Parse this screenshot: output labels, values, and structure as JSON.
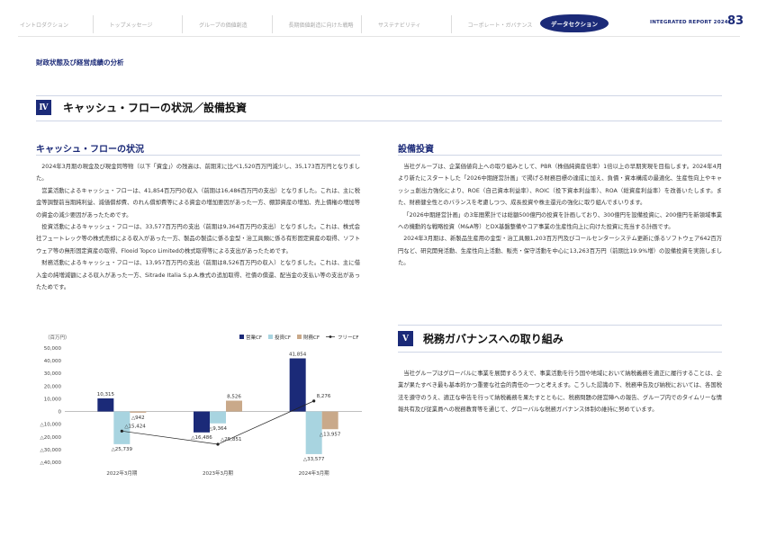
{
  "nav": {
    "items": [
      "イントロダクション",
      "トップメッセージ",
      "グループの価値創造",
      "長期価値創造に向けた戦略",
      "サステナビリティ",
      "コーポレート・ガバナンス"
    ],
    "active": "データセクション"
  },
  "header": {
    "report": "INTEGRATED REPORT 2024",
    "page": "83"
  },
  "section_title": "財政状態及び経営成績の分析",
  "main_heading": {
    "badge": "Ⅳ",
    "title": "キャッシュ・フローの状況／設備投資"
  },
  "cashflow": {
    "heading": "キャッシュ・フローの状況",
    "paragraphs": [
      "2024年3月期の現金及び現金同等物（以下「資金」）の残高は、前期末に比べ1,520百万円減少し、35,173百万円となりました。",
      "営業活動によるキャッシュ・フローは、41,854百万円の収入（前期は16,486百万円の支出）となりました。これは、主に税金等調整前当期純利益、減価償却費、のれん償却費等による資金の増加要因があった一方、棚卸資産の増加、売上債権の増加等の資金の減少要因があったためです。",
      "投資活動によるキャッシュ・フローは、33,577百万円の支出（前期は9,364百万円の支出）となりました。これは、株式会社フュートレック等の株式売却による収入があった一方、製品の製造に係る金型・治工具類に係る有形固定資産の取得、ソフトウェア等の無形固定資産の取得、Flooid Topco Limitedの株式取得等による支出があったためです。",
      "財務活動によるキャッシュ・フローは、13,957百万円の支出（前期は8,526百万円の収入）となりました。これは、主に借入金の純増減額による収入があった一方、Sitrade Italia S.p.A.株式の追加取得、社債の償還、配当金の支払い等の支出があったためです。"
    ]
  },
  "capex": {
    "heading": "設備投資",
    "paragraphs": [
      "当社グループは、企業価値向上への取り組みとして、PBR（株価純資産倍率）1倍以上の早期実現を目指します。2024年4月より新たにスタートした「2026中期経営計画」で掲げる財務目標の達成に加え、負債・資本構成の最適化、生産性向上やキャッシュ創出力強化により、ROE（自己資本利益率）、ROIC（投下資本利益率）、ROA（総資産利益率）を改善いたします。また、財務健全性とのバランスを考慮しつつ、成長投資や株主還元の強化に取り組んでまいります。",
      "「2026中期経営計画」の3年間累計では総額500億円の投資を計画しており、300億円を設備投資に、200億円を新領域事業への機動的な戦略投資（M&A等）とDX基盤整備やコア事業の生産性向上に向けた投資に充当する計画です。",
      "2024年3月期は、新製品生産用の金型・治工具類1,203百万円及びコールセンターシステム更新に係るソフトウェア642百万円など、研究開発活動、生産性向上活動、販売・保守活動を中心に13,263百万円（前期比19.9%増）の設備投資を実施しました。"
    ]
  },
  "tax": {
    "badge": "Ⅴ",
    "heading": "税務ガバナンスへの取り組み",
    "paragraphs": [
      "当社グループはグローバルに事業を展開するうえで、事業活動を行う国や地域において納税義務を適正に履行することは、企業が果たすべき最も基本的かつ重要な社会的責任の一つと考えます。こうした認識の下、税務申告及び納税においては、各国税法を遵守のうえ、適正な申告を行って納税義務を果たすとともに、税務問題の経営陣への報告、グループ内でのタイムリーな情報共有及び従業員への税務教育等を通じて、グローバルな税務ガバナンス体制の維持に努めています。"
    ]
  },
  "chart_data": {
    "type": "bar",
    "unit_label": "（百万円）",
    "categories": [
      "2022年3月期",
      "2023年3月期",
      "2024年3月期"
    ],
    "ylim": [
      -40000,
      50000
    ],
    "yticks": [
      "50,000",
      "40,000",
      "30,000",
      "20,000",
      "10,000",
      "0",
      "△10,000",
      "△20,000",
      "△30,000",
      "△40,000"
    ],
    "ytick_values": [
      50000,
      40000,
      30000,
      20000,
      10000,
      0,
      -10000,
      -20000,
      -30000,
      -40000
    ],
    "series": [
      {
        "name": "営業CF",
        "color": "#1b2a78",
        "values": [
          10315,
          -16486,
          41854
        ],
        "labels": [
          "10,315",
          "△16,486",
          "41,854"
        ]
      },
      {
        "name": "投資CF",
        "color": "#a8d4e0",
        "values": [
          -25739,
          -9364,
          -33577
        ],
        "labels": [
          "△25,739",
          "△9,364",
          "△33,577"
        ]
      },
      {
        "name": "財務CF",
        "color": "#c9a98a",
        "values": [
          -942,
          8526,
          -13957
        ],
        "labels": [
          "△942",
          "8,526",
          "△13,957"
        ]
      }
    ],
    "line": {
      "name": "フリーCF",
      "color": "#222222",
      "values": [
        -15424,
        -25851,
        8276
      ],
      "labels": [
        "△15,424",
        "△25,851",
        "8,276"
      ]
    },
    "legend_position": "top-right"
  }
}
